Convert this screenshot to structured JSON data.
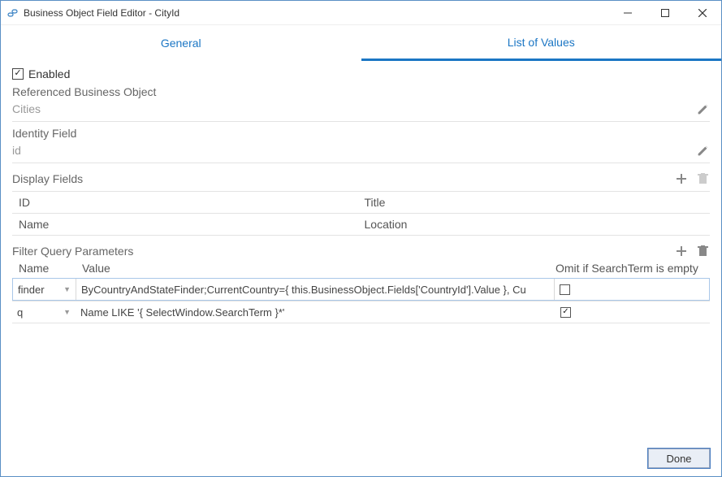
{
  "window": {
    "title": "Business Object Field Editor - CityId"
  },
  "tabs": {
    "general": "General",
    "lov": "List of Values"
  },
  "enabled": {
    "label": "Enabled",
    "checked": true
  },
  "refObj": {
    "label": "Referenced Business Object",
    "value": "Cities"
  },
  "identity": {
    "label": "Identity Field",
    "value": "id"
  },
  "displayFields": {
    "label": "Display Fields",
    "cols": [
      "ID",
      "Title"
    ],
    "rows": [
      [
        "Name",
        "Location"
      ]
    ]
  },
  "filter": {
    "label": "Filter Query Parameters",
    "cols": {
      "name": "Name",
      "value": "Value",
      "omit": "Omit if SearchTerm is empty"
    },
    "rows": [
      {
        "name": "finder",
        "value": "ByCountryAndStateFinder;CurrentCountry={ this.BusinessObject.Fields['CountryId'].Value }, Cu",
        "omit": false
      },
      {
        "name": "q",
        "value": "Name LIKE '{ SelectWindow.SearchTerm }*'",
        "omit": true
      }
    ]
  },
  "footer": {
    "done": "Done"
  }
}
